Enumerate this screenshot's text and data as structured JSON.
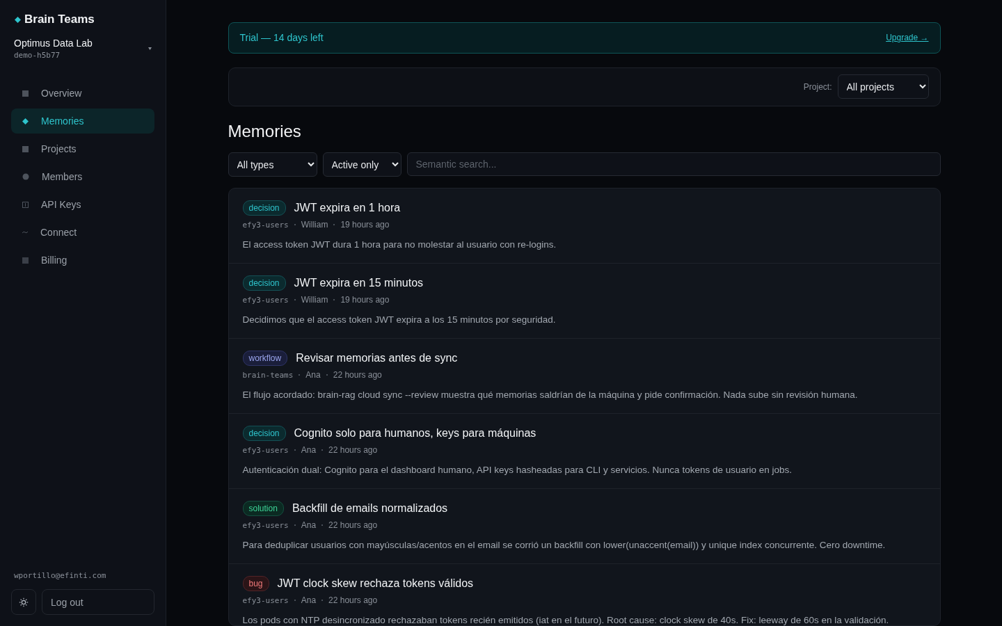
{
  "sidebar": {
    "brand": "Brain Teams",
    "org": {
      "name": "Optimus Data Lab",
      "slug": "demo-h5b77"
    },
    "items": [
      {
        "label": "Overview",
        "selected": false
      },
      {
        "label": "Memories",
        "selected": true
      },
      {
        "label": "Projects",
        "selected": false
      },
      {
        "label": "Members",
        "selected": false
      },
      {
        "label": "API Keys",
        "selected": false
      },
      {
        "label": "Connect",
        "selected": false
      },
      {
        "label": "Billing",
        "selected": false
      }
    ],
    "email": "wportillo@efinti.com",
    "logout": "Log out"
  },
  "trial": {
    "text": "Trial — 14 days left",
    "link": "Upgrade →"
  },
  "project_filter": {
    "label": "Project:",
    "value": "All projects"
  },
  "title": "Memories",
  "filters": {
    "type": "All types",
    "status": "Active only",
    "search": {
      "placeholder": "Semantic search..."
    }
  },
  "memories": [
    {
      "kind": "decision",
      "tag": "decision",
      "title": "JWT expira en 1 hora",
      "project": "efy3-users",
      "author": "William",
      "time": "19 hours ago",
      "text": "El access token JWT dura 1 hora para no molestar al usuario con re-logins."
    },
    {
      "kind": "decision",
      "tag": "decision",
      "title": "JWT expira en 15 minutos",
      "project": "efy3-users",
      "author": "William",
      "time": "19 hours ago",
      "text": "Decidimos que el access token JWT expira a los 15 minutos por seguridad."
    },
    {
      "kind": "workflow",
      "tag": "workflow",
      "title": "Revisar memorias antes de sync",
      "project": "brain-teams",
      "author": "Ana",
      "time": "22 hours ago",
      "text": "El flujo acordado: brain-rag cloud sync --review muestra qué memorias saldrían de la máquina y pide confirmación. Nada sube sin revisión humana."
    },
    {
      "kind": "decision",
      "tag": "decision",
      "title": "Cognito solo para humanos, keys para máquinas",
      "project": "efy3-users",
      "author": "Ana",
      "time": "22 hours ago",
      "text": "Autenticación dual: Cognito para el dashboard humano, API keys hasheadas para CLI y servicios. Nunca tokens de usuario en jobs."
    },
    {
      "kind": "solution",
      "tag": "solution",
      "title": "Backfill de emails normalizados",
      "project": "efy3-users",
      "author": "Ana",
      "time": "22 hours ago",
      "text": "Para deduplicar usuarios con mayúsculas/acentos en el email se corrió un backfill con lower(unaccent(email)) y unique index concurrente. Cero downtime."
    },
    {
      "kind": "bug",
      "tag": "bug",
      "title": "JWT clock skew rechaza tokens válidos",
      "project": "efy3-users",
      "author": "Ana",
      "time": "22 hours ago",
      "text": "Los pods con NTP desincronizado rechazaban tokens recién emitidos (iat en el futuro). Root cause: clock skew de 40s. Fix: leeway de 60s en la validación."
    }
  ]
}
